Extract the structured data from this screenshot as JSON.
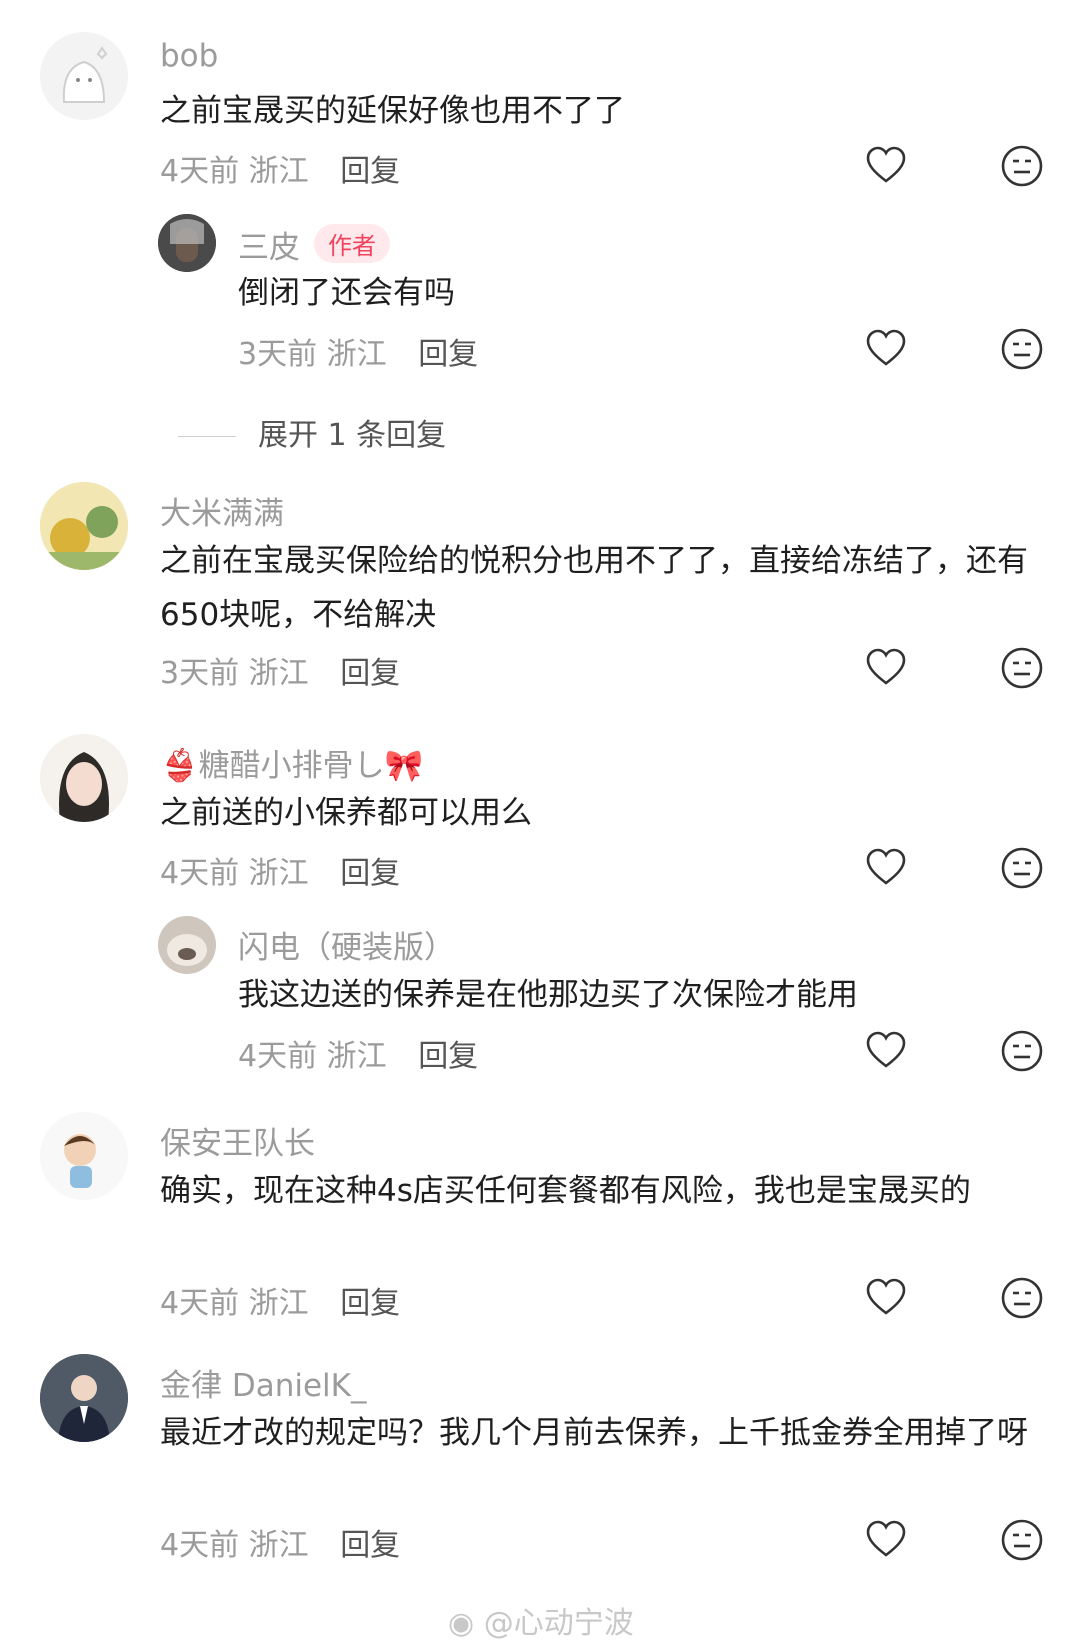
{
  "watermark": {
    "icon": "weibo-icon",
    "text": "@心动宁波"
  },
  "comments": [
    {
      "name": "bob",
      "text": "之前宝晟买的延保好像也用不了了",
      "time": "4天前",
      "location": "浙江",
      "reply_label": "回复",
      "avatar": "ghost-avatar"
    },
    {
      "name": "三皮",
      "badge": "作者",
      "text": "倒闭了还会有吗",
      "time": "3天前",
      "location": "浙江",
      "reply_label": "回复",
      "avatar": "portrait-avatar"
    },
    {
      "name": "大米满满",
      "text": "之前在宝晟买保险给的悦积分也用不了了，直接给冻结了，还有650块呢，不给解决",
      "time": "3天前",
      "location": "浙江",
      "reply_label": "回复",
      "avatar": "painting-avatar"
    },
    {
      "name": "👙糖醋小排骨し🎀",
      "text": "之前送的小保养都可以用么",
      "time": "4天前",
      "location": "浙江",
      "reply_label": "回复",
      "avatar": "girl-avatar"
    },
    {
      "name": "闪电（硬装版）",
      "text": "我这边送的保养是在他那边买了次保险才能用",
      "time": "4天前",
      "location": "浙江",
      "reply_label": "回复",
      "avatar": "dog-avatar"
    },
    {
      "name": "保安王队长",
      "text": "确实，现在这种4s店买任何套餐都有风险，我也是宝晟买的",
      "time": "4天前",
      "location": "浙江",
      "reply_label": "回复",
      "avatar": "cartoon-avatar"
    },
    {
      "name": "金律 DanielK_",
      "text": "最近才改的规定吗？我几个月前去保养，上千抵金券全用掉了呀",
      "time": "4天前",
      "location": "浙江",
      "reply_label": "回复",
      "avatar": "suit-avatar"
    }
  ],
  "expand_replies": "展开 1 条回复",
  "colors": {
    "badge_bg": "#ffe9ec",
    "badge_text": "#f0435d",
    "secondary_text": "#9b9b9b"
  }
}
